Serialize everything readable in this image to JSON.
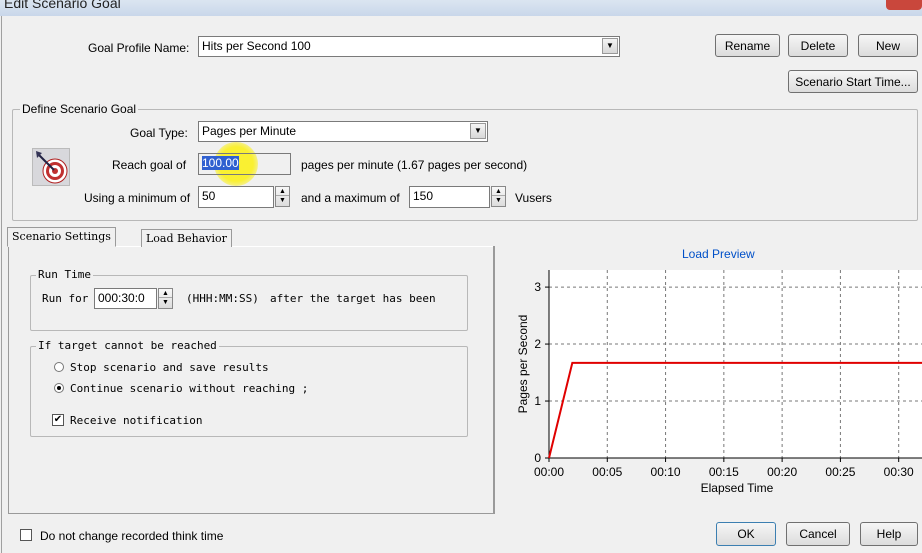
{
  "window": {
    "title": "Edit Scenario Goal"
  },
  "goal_profile": {
    "label": "Goal Profile Name:",
    "value": "Hits per Second 100",
    "rename": "Rename",
    "delete": "Delete",
    "new": "New",
    "start_time": "Scenario Start Time..."
  },
  "define_goal": {
    "title": "Define Scenario Goal",
    "goal_type_label": "Goal Type:",
    "goal_type_value": "Pages per Minute",
    "reach_label": "Reach goal of",
    "reach_value": "100.00",
    "reach_suffix": "pages per minute (1.67 pages per second)",
    "min_label": "Using a minimum of",
    "min_value": "50",
    "max_label": "and a maximum of",
    "max_value": "150",
    "vusers": "Vusers"
  },
  "tabs": [
    {
      "label": "Scenario Settings"
    },
    {
      "label": "Load Behavior"
    }
  ],
  "run_time": {
    "title": "Run Time",
    "run_for": "Run for",
    "value": "000:30:0",
    "format": "(HHH:MM:SS)",
    "after": "after the target has been"
  },
  "not_reached": {
    "title": "If target cannot be reached",
    "stop": "Stop scenario and save results",
    "continue": "Continue scenario without reaching ;",
    "notify": "Receive notification",
    "selected": "continue",
    "notify_checked": true
  },
  "preview": {
    "title": "Load Preview"
  },
  "chart_data": {
    "type": "line",
    "title": "Load Preview",
    "xlabel": "Elapsed Time",
    "ylabel": "Pages per Second",
    "x_ticks": [
      "00:00",
      "00:05",
      "00:10",
      "00:15",
      "00:20",
      "00:25",
      "00:30"
    ],
    "y_ticks": [
      "0",
      "1",
      "2",
      "3"
    ],
    "ylim": [
      0,
      3.3
    ],
    "xlim_minutes": [
      0,
      32
    ],
    "grid": true,
    "series": [
      {
        "color": "#e00000",
        "x_minutes": [
          0,
          2,
          32
        ],
        "y": [
          0,
          1.67,
          1.67
        ]
      }
    ]
  },
  "footer": {
    "think_time": "Do not change recorded think time",
    "ok": "OK",
    "cancel": "Cancel",
    "help": "Help"
  },
  "colors": {
    "accent": "#0050c8",
    "series": "#e00000",
    "highlight": "#f5ee2a"
  }
}
